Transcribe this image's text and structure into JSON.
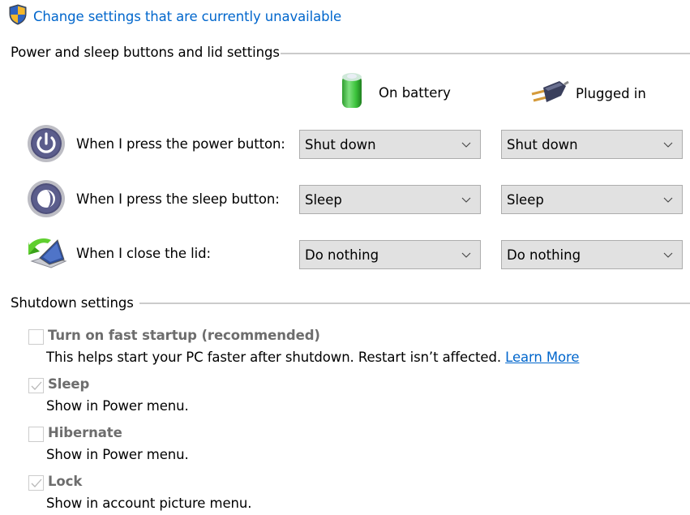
{
  "header": {
    "change_settings_link": "Change settings that are currently unavailable",
    "shield_icon": "uac-shield-icon"
  },
  "power_section": {
    "title": "Power and sleep buttons and lid settings",
    "columns": [
      {
        "label": "On battery",
        "icon": "battery-icon"
      },
      {
        "label": "Plugged in",
        "icon": "plug-icon"
      }
    ],
    "rows": [
      {
        "label": "When I press the power button:",
        "icon": "power-button-icon",
        "on_battery": "Shut down",
        "plugged_in": "Shut down"
      },
      {
        "label": "When I press the sleep button:",
        "icon": "sleep-button-icon",
        "on_battery": "Sleep",
        "plugged_in": "Sleep"
      },
      {
        "label": "When I close the lid:",
        "icon": "laptop-lid-icon",
        "on_battery": "Do nothing",
        "plugged_in": "Do nothing"
      }
    ]
  },
  "shutdown_section": {
    "title": "Shutdown settings",
    "options": [
      {
        "label": "Turn on fast startup (recommended)",
        "checked": false,
        "description": "This helps start your PC faster after shutdown. Restart isn’t affected. ",
        "link": "Learn More"
      },
      {
        "label": "Sleep",
        "checked": true,
        "description": "Show in Power menu."
      },
      {
        "label": "Hibernate",
        "checked": false,
        "description": "Show in Power menu."
      },
      {
        "label": "Lock",
        "checked": true,
        "description": "Show in account picture menu."
      }
    ]
  },
  "colors": {
    "link": "#0066cc",
    "combo_bg": "#e1e1e1",
    "combo_border": "#adadad",
    "disabled_label": "#6d6d6d",
    "divider": "#cbcbcb"
  }
}
